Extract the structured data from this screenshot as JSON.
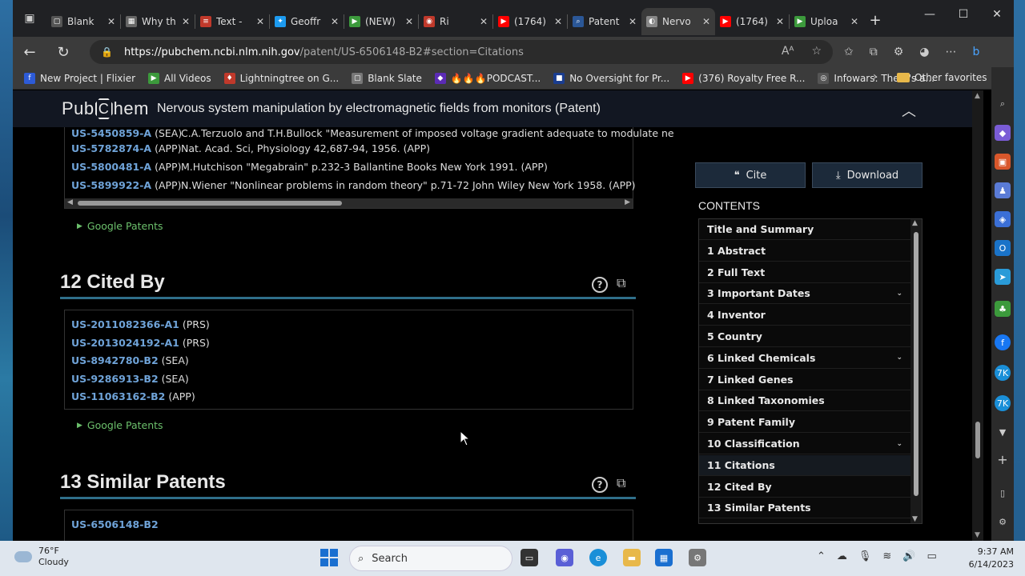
{
  "tabs": [
    {
      "title": "Blank",
      "color": "#555555",
      "glyph": "▢"
    },
    {
      "title": "Why th",
      "color": "#666666",
      "glyph": "▦"
    },
    {
      "title": "Text -",
      "color": "#c0392b",
      "glyph": "≡"
    },
    {
      "title": "Geoffr",
      "color": "#1d9bf0",
      "glyph": "✦"
    },
    {
      "title": "(NEW)",
      "color": "#3c9a3c",
      "glyph": "▶"
    },
    {
      "title": "Ri",
      "color": "#c0392b",
      "glyph": "◉"
    },
    {
      "title": "(1764)",
      "color": "#ff0000",
      "glyph": "▶"
    },
    {
      "title": "Patent",
      "color": "#2b5797",
      "glyph": "⌕"
    },
    {
      "title": "Nervo",
      "color": "#888888",
      "glyph": "◐"
    },
    {
      "title": "(1764)",
      "color": "#ff0000",
      "glyph": "▶"
    },
    {
      "title": "Uploa",
      "color": "#3c9a3c",
      "glyph": "▶"
    }
  ],
  "address": {
    "host": "https://pubchem.ncbi.nlm.nih.gov",
    "path": "/patent/US-6506148-B2#section=Citations"
  },
  "bookmarks": [
    {
      "label": "New Project | Flixier",
      "color": "#2d5bd7",
      "glyph": "f"
    },
    {
      "label": "All Videos",
      "color": "#3c9a3c",
      "glyph": "▶"
    },
    {
      "label": "Lightningtree on G...",
      "color": "#c0392b",
      "glyph": "♦"
    },
    {
      "label": "Blank Slate",
      "color": "#777777",
      "glyph": "▢"
    },
    {
      "label": "🔥🔥🔥PODCAST...",
      "color": "#5b2bb5",
      "glyph": "◆"
    },
    {
      "label": "No Oversight for Pr...",
      "color": "#1a3d8f",
      "glyph": "■"
    },
    {
      "label": "(376) Royalty Free R...",
      "color": "#ff0000",
      "glyph": "▶"
    },
    {
      "label": "Infowars: There's a...",
      "color": "#555555",
      "glyph": "◎"
    }
  ],
  "bookmarks_other": "Other favorites",
  "header": {
    "logo_left": "Pub",
    "logo_c": "C",
    "logo_right": "hem",
    "title": "Nervous system manipulation by electromagnetic fields from monitors (Patent)"
  },
  "citations": [
    {
      "id": "US-5450859-A",
      "type": "(SEA)",
      "desc": "C.A.Terzuolo and T.H.Bullock \"Measurement of imposed voltage gradient adequate to modulate ne"
    },
    {
      "id": "US-5782874-A",
      "type": "(APP)",
      "desc": "Nat. Acad. Sci, Physiology 42,687-94, 1956. (APP)"
    },
    {
      "id": "US-5800481-A",
      "type": "(APP)",
      "desc": "M.Hutchison \"Megabrain\" p.232-3 Ballantine Books New York 1991. (APP)"
    },
    {
      "id": "US-5899922-A",
      "type": "(APP)",
      "desc": "N.Wiener \"Nonlinear problems in random theory\" p.71-72 John Wiley New York 1958. (APP)"
    }
  ],
  "google_patents_label": "Google Patents",
  "sections": {
    "cited_by": "12 Cited By",
    "similar": "13 Similar Patents"
  },
  "cited_by": [
    {
      "id": "US-2011082366-A1",
      "type": "(PRS)"
    },
    {
      "id": "US-2013024192-A1",
      "type": "(PRS)"
    },
    {
      "id": "US-8942780-B2",
      "type": "(SEA)"
    },
    {
      "id": "US-9286913-B2",
      "type": "(SEA)"
    },
    {
      "id": "US-11063162-B2",
      "type": "(APP)"
    }
  ],
  "similar": [
    {
      "id": "US-6506148-B2"
    }
  ],
  "buttons": {
    "cite": "Cite",
    "download": "Download"
  },
  "contents_heading": "CONTENTS",
  "toc": [
    {
      "label": "Title and Summary",
      "chevron": false
    },
    {
      "label": "1 Abstract",
      "chevron": false
    },
    {
      "label": "2 Full Text",
      "chevron": false
    },
    {
      "label": "3 Important Dates",
      "chevron": true
    },
    {
      "label": "4 Inventor",
      "chevron": false
    },
    {
      "label": "5 Country",
      "chevron": false
    },
    {
      "label": "6 Linked Chemicals",
      "chevron": true
    },
    {
      "label": "7 Linked Genes",
      "chevron": false
    },
    {
      "label": "8 Linked Taxonomies",
      "chevron": false
    },
    {
      "label": "9 Patent Family",
      "chevron": false
    },
    {
      "label": "10 Classification",
      "chevron": true
    },
    {
      "label": "11 Citations",
      "chevron": false,
      "active": true
    },
    {
      "label": "12 Cited By",
      "chevron": false
    },
    {
      "label": "13 Similar Patents",
      "chevron": false
    }
  ],
  "taskbar": {
    "temp": "76°F",
    "condition": "Cloudy",
    "search_placeholder": "Search",
    "time": "9:37 AM",
    "date": "6/14/2023"
  }
}
